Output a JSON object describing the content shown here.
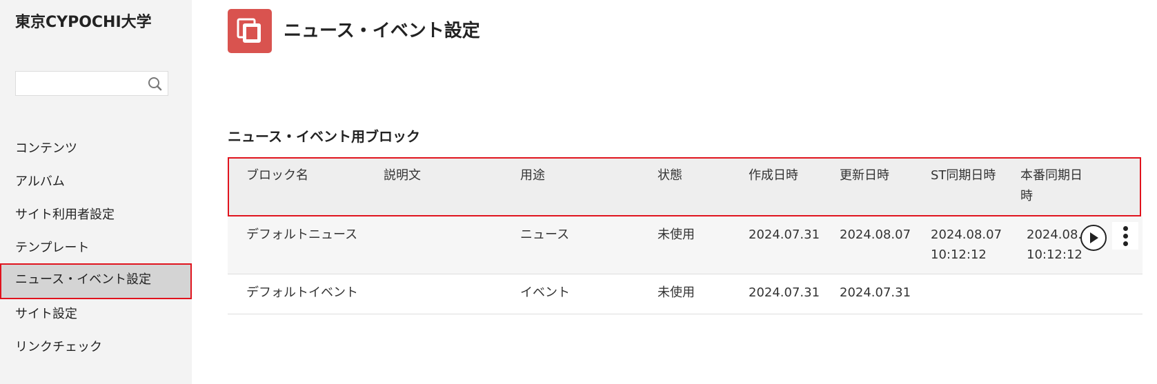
{
  "sidebar": {
    "brand": "東京CYPOCHI大学",
    "search": {
      "value": "",
      "placeholder": "",
      "icon": "search-icon"
    },
    "items": [
      {
        "label": "コンテンツ",
        "active": false
      },
      {
        "label": "アルバム",
        "active": false
      },
      {
        "label": "サイト利用者設定",
        "active": false
      },
      {
        "label": "テンプレート",
        "active": false
      },
      {
        "label": "ニュース・イベント設定",
        "active": true
      },
      {
        "label": "サイト設定",
        "active": false
      },
      {
        "label": "リンクチェック",
        "active": false
      }
    ]
  },
  "header": {
    "icon": "copy-icon",
    "icon_color": "#d9534f",
    "title": "ニュース・イベント設定"
  },
  "section": {
    "title": "ニュース・イベント用ブロック"
  },
  "table": {
    "columns": {
      "name": "ブロック名",
      "description": "説明文",
      "usage": "用途",
      "status": "状態",
      "created": "作成日時",
      "updated": "更新日時",
      "st_sync": "ST同期日時",
      "prod_sync_1": "本番同期日",
      "prod_sync_2": "時"
    },
    "rows": [
      {
        "name": "デフォルトニュース",
        "description": "",
        "usage": "ニュース",
        "status": "未使用",
        "created": "2024.07.31",
        "updated": "2024.08.07",
        "st_sync_date": "2024.08.07",
        "st_sync_time": "10:12:12",
        "prod_sync_date": "2024.08.",
        "prod_sync_time": "10:12:12"
      },
      {
        "name": "デフォルトイベント",
        "description": "",
        "usage": "イベント",
        "status": "未使用",
        "created": "2024.07.31",
        "updated": "2024.07.31"
      }
    ],
    "actions": {
      "play": "play-icon",
      "more": "more-vertical-icon"
    }
  },
  "colors": {
    "accent": "#e0131d",
    "sidebar_bg": "#f3f3f3",
    "active_bg": "#d4d4d4"
  }
}
